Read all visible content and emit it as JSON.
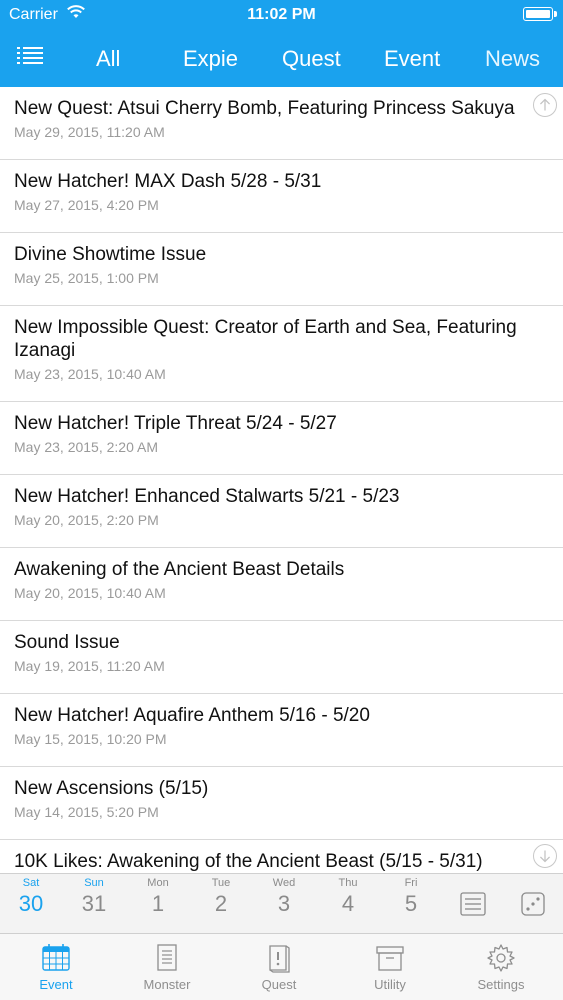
{
  "status_bar": {
    "carrier": "Carrier",
    "time": "11:02 PM"
  },
  "nav": {
    "tabs": [
      "All",
      "Expie",
      "Quest",
      "Event",
      "News"
    ],
    "active_tab": "News"
  },
  "news_items": [
    {
      "title": "New Quest: Atsui Cherry Bomb, Featuring Princess Sakuya",
      "date": "May 29, 2015, 11:20 AM"
    },
    {
      "title": "New Hatcher! MAX Dash 5/28 - 5/31",
      "date": "May 27, 2015, 4:20 PM"
    },
    {
      "title": "Divine Showtime Issue",
      "date": "May 25, 2015, 1:00 PM"
    },
    {
      "title": "New Impossible Quest: Creator of Earth and Sea, Featuring Izanagi",
      "date": "May 23, 2015, 10:40 AM"
    },
    {
      "title": "New Hatcher! Triple Threat 5/24 - 5/27",
      "date": "May 23, 2015, 2:20 AM"
    },
    {
      "title": "New Hatcher! Enhanced Stalwarts 5/21 - 5/23",
      "date": "May 20, 2015, 2:20 PM"
    },
    {
      "title": "Awakening of the Ancient Beast Details",
      "date": "May 20, 2015, 10:40 AM"
    },
    {
      "title": "Sound Issue",
      "date": "May 19, 2015, 11:20 AM"
    },
    {
      "title": "New Hatcher! Aquafire Anthem 5/16 - 5/20",
      "date": "May 15, 2015, 10:20 PM"
    },
    {
      "title": "New Ascensions (5/15)",
      "date": "May 14, 2015, 5:20 PM"
    },
    {
      "title": "10K Likes: Awakening of the Ancient Beast (5/15 - 5/31)",
      "date": ""
    }
  ],
  "calendar": {
    "days": [
      {
        "dow": "Sat",
        "num": "30"
      },
      {
        "dow": "Sun",
        "num": "31"
      },
      {
        "dow": "Mon",
        "num": "1"
      },
      {
        "dow": "Tue",
        "num": "2"
      },
      {
        "dow": "Wed",
        "num": "3"
      },
      {
        "dow": "Thu",
        "num": "4"
      },
      {
        "dow": "Fri",
        "num": "5"
      }
    ],
    "today_index": 0
  },
  "tabbar": {
    "items": [
      {
        "label": "Event",
        "icon": "calendar-icon"
      },
      {
        "label": "Monster",
        "icon": "list-document-icon"
      },
      {
        "label": "Quest",
        "icon": "book-icon"
      },
      {
        "label": "Utility",
        "icon": "box-icon"
      },
      {
        "label": "Settings",
        "icon": "gear-icon"
      }
    ],
    "active_index": 0
  },
  "colors": {
    "accent": "#1aa2ee",
    "text": "#111111",
    "subtext": "#9a9a9a",
    "separator": "#d9d9d9"
  }
}
